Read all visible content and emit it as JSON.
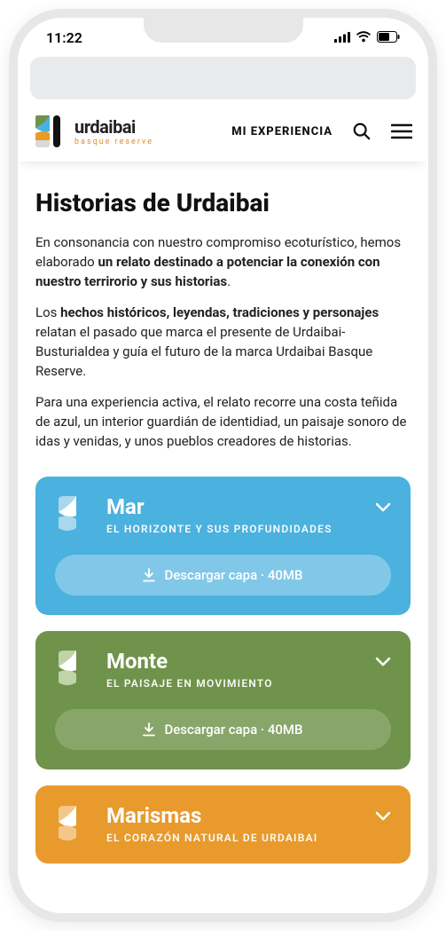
{
  "statusbar": {
    "time": "11:22"
  },
  "header": {
    "brand_name": "urdaibai",
    "brand_tag": "basque reserve",
    "nav_label": "MI EXPERIENCIA"
  },
  "page": {
    "title": "Historias de Urdaibai",
    "p1_a": "En consonancia con nuestro compromiso ecoturístico, hemos elaborado ",
    "p1_b": "un relato destinado a potenciar la conexión con nuestro terrirorio y sus historias",
    "p1_c": ".",
    "p2_a": "Los ",
    "p2_b": "hechos históricos, leyendas, tradiciones y personajes",
    "p2_c": " relatan el pasado que marca el presente de Urdaibai-Busturialdea y guía el futuro de la marca Urdaibai Basque Reserve.",
    "p3": "Para una experiencia activa, el relato recorre una costa teñida de azul, un interior guardián de identidiad, un paisaje sonoro de idas y venidas, y unos pueblos creadores de historias."
  },
  "cards": [
    {
      "key": "mar",
      "title": "Mar",
      "subtitle": "EL HORIZONTE Y SUS PROFUNDIDADES",
      "download": "Descargar capa · 40MB"
    },
    {
      "key": "monte",
      "title": "Monte",
      "subtitle": "EL PAISAJE EN MOVIMIENTO",
      "download": "Descargar capa · 40MB"
    },
    {
      "key": "marismas",
      "title": "Marismas",
      "subtitle": "EL CORAZÓN NATURAL DE URDAIBAI"
    }
  ]
}
